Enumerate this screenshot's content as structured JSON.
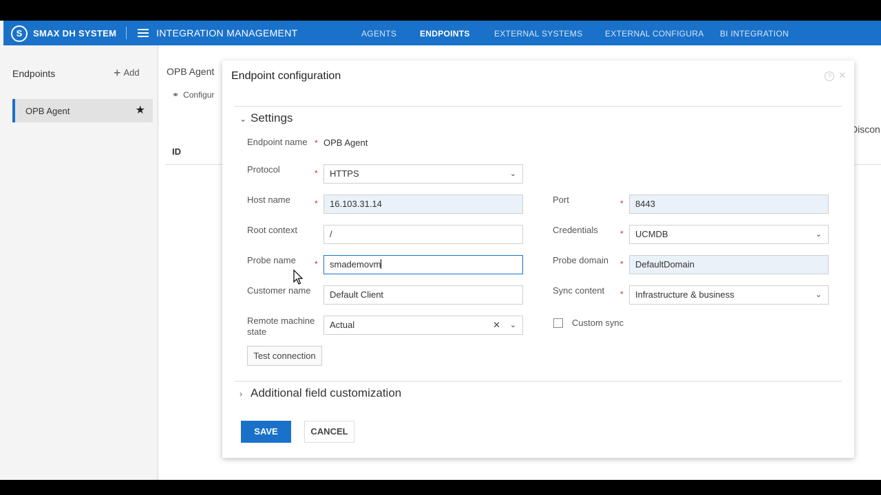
{
  "topbar": {
    "brand": "SMAX DH SYSTEM",
    "app_title": "INTEGRATION MANAGEMENT",
    "nav": [
      "AGENTS",
      "ENDPOINTS",
      "EXTERNAL SYSTEMS",
      "EXTERNAL CONFIGURA",
      "BI INTEGRATION"
    ],
    "active_nav": "ENDPOINTS",
    "brand_color": "#1a71c9"
  },
  "left_panel": {
    "title": "Endpoints",
    "add_label": "Add",
    "items": [
      {
        "label": "OPB Agent",
        "favorite": true
      }
    ]
  },
  "background_content": {
    "title": "OPB Agent",
    "config_tab": "Configur",
    "column_id": "ID",
    "column_disconnect": "Discon"
  },
  "modal": {
    "title": "Endpoint configuration",
    "settings_section": "Settings",
    "fields": {
      "endpoint_name": {
        "label": "Endpoint name",
        "value": "OPB Agent"
      },
      "protocol": {
        "label": "Protocol",
        "value": "HTTPS"
      },
      "host_name": {
        "label": "Host name",
        "value": "16.103.31.14"
      },
      "port": {
        "label": "Port",
        "value": "8443"
      },
      "root_context": {
        "label": "Root context",
        "value": "/"
      },
      "credentials": {
        "label": "Credentials",
        "value": "UCMDB"
      },
      "probe_name": {
        "label": "Probe name",
        "value": "smademovm"
      },
      "probe_domain": {
        "label": "Probe domain",
        "value": "DefaultDomain"
      },
      "customer_name": {
        "label": "Customer name",
        "value": "Default Client"
      },
      "sync_content": {
        "label": "Sync content",
        "value": "Infrastructure & business"
      },
      "remote_machine_state": {
        "label_line1": "Remote machine",
        "label_line2": "state",
        "value": "Actual"
      },
      "custom_sync": {
        "label": "Custom sync",
        "checked": false
      }
    },
    "test_connection_label": "Test connection",
    "additional_section": "Additional field customization",
    "save_label": "SAVE",
    "cancel_label": "CANCEL",
    "required_marker": "*"
  }
}
